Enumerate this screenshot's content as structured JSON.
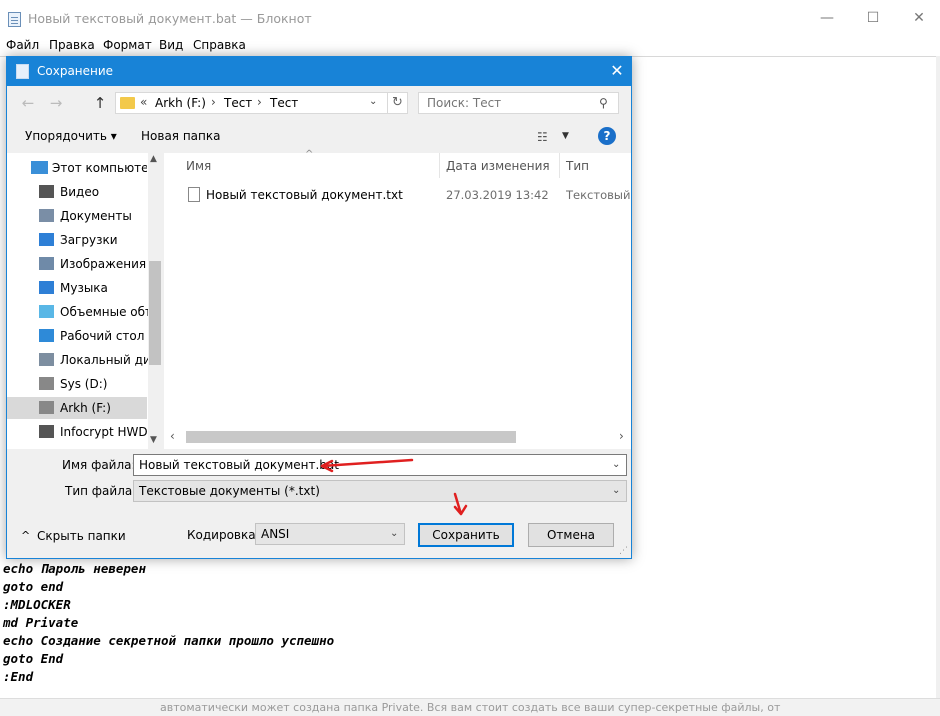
{
  "notepad": {
    "title": "Новый текстовый документ.bat — Блокнот",
    "window_controls": {
      "minimize": "—",
      "maximize": "☐",
      "close": "✕"
    },
    "menu": [
      "Файл",
      "Правка",
      "Формат",
      "Вид",
      "Справка"
    ],
    "lines": [
      "echo Пароль неверен",
      "goto end",
      ":MDLOCKER",
      "md Private",
      "echo Создание секретной папки прошло успешно",
      "goto End",
      ":End"
    ],
    "bottom_text": "автоматически может создана папка Private. Вся вам стоит создать все ваши супер-секретные файлы, от"
  },
  "dialog": {
    "title": "Сохранение",
    "close_glyph": "✕",
    "nav": {
      "back": "←",
      "forward": "→",
      "up": "↑"
    },
    "address": {
      "prefix": "«",
      "segments": [
        "Arkh (F:)",
        "Тест",
        "Тест"
      ],
      "separator": "›"
    },
    "search_placeholder": "Поиск: Тест",
    "toolbar": {
      "organize": "Упорядочить ▾",
      "new_folder": "Новая папка",
      "help": "?"
    },
    "nav_pane": [
      {
        "label": "Этот компьютер",
        "icon": "computer-icon",
        "color": "#3a8fd8",
        "top": true
      },
      {
        "label": "Видео",
        "icon": "video-icon",
        "color": "#555555"
      },
      {
        "label": "Документы",
        "icon": "documents-icon",
        "color": "#7a8ea6"
      },
      {
        "label": "Загрузки",
        "icon": "downloads-icon",
        "color": "#2e7fd6"
      },
      {
        "label": "Изображения",
        "icon": "pictures-icon",
        "color": "#6f8aa8"
      },
      {
        "label": "Музыка",
        "icon": "music-icon",
        "color": "#2e7fd6"
      },
      {
        "label": "Объемные объ",
        "icon": "3d-objects-icon",
        "color": "#59b7e6"
      },
      {
        "label": "Рабочий стол",
        "icon": "desktop-icon",
        "color": "#2e8ad8"
      },
      {
        "label": "Локальный дис",
        "icon": "local-disk-icon",
        "color": "#7d8ea0"
      },
      {
        "label": "Sys (D:)",
        "icon": "drive-icon",
        "color": "#888888"
      },
      {
        "label": "Arkh (F:)",
        "icon": "drive-icon",
        "color": "#888888",
        "selected": true
      },
      {
        "label": "Infocrypt HWDS",
        "icon": "drive-icon",
        "color": "#555555"
      }
    ],
    "columns": {
      "name": "Имя",
      "date": "Дата изменения",
      "type": "Тип"
    },
    "files": [
      {
        "name": "Новый текстовый документ.txt",
        "date": "27.03.2019 13:42",
        "type": "Текстовый докум"
      }
    ],
    "filename_label": "Имя файла:",
    "filename_value": "Новый текстовый документ.bat",
    "filetype_label": "Тип файла:",
    "filetype_value": "Текстовые документы (*.txt)",
    "hide_folders": "Скрыть папки",
    "encoding_label": "Кодировка:",
    "encoding_value": "ANSI",
    "save": "Сохранить",
    "cancel": "Отмена",
    "arrow_color": "#e02020"
  }
}
